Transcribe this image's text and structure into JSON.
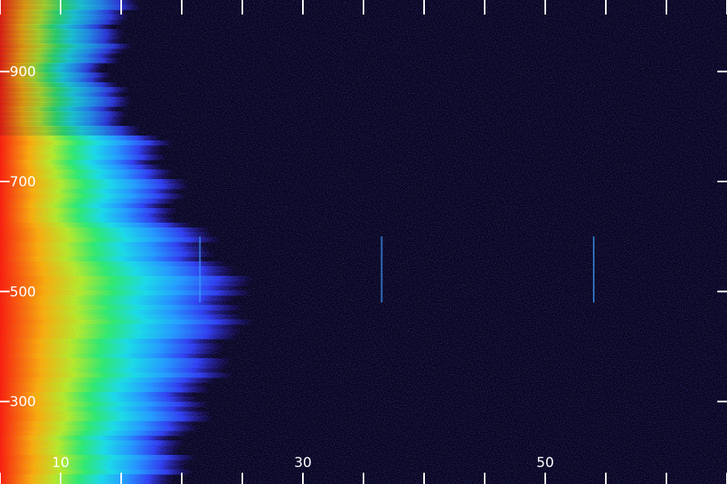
{
  "chart_data": {
    "type": "heatmap",
    "title": "",
    "xlabel": "",
    "ylabel": "",
    "xlim": [
      5,
      65
    ],
    "ylim": [
      150,
      1030
    ],
    "x_tick_labels": [
      "10",
      "30",
      "50"
    ],
    "y_tick_labels": [
      "300",
      "500",
      "700",
      "900"
    ],
    "x_ticks": [
      10,
      30,
      50
    ],
    "y_ticks": [
      300,
      500,
      700,
      900
    ],
    "colormap": [
      "#06041e",
      "#2a10a8",
      "#2b3cf0",
      "#1e9cff",
      "#14e0e8",
      "#2af06a",
      "#b8f020",
      "#ffb000",
      "#ff1800"
    ],
    "intensity_profile": [
      {
        "y": 1000,
        "edge_x": 18.5
      },
      {
        "y": 900,
        "edge_x": 16.5
      },
      {
        "y": 800,
        "edge_x": 19.0
      },
      {
        "y": 700,
        "edge_x": 21.5
      },
      {
        "y": 600,
        "edge_x": 22.0
      },
      {
        "y": 500,
        "edge_x": 25.5
      },
      {
        "y": 400,
        "edge_x": 24.0
      },
      {
        "y": 300,
        "edge_x": 22.0
      },
      {
        "y": 200,
        "edge_x": 20.0
      }
    ],
    "vertical_streaks_x": [
      21.5,
      36.5,
      54.0
    ],
    "grid": false
  }
}
